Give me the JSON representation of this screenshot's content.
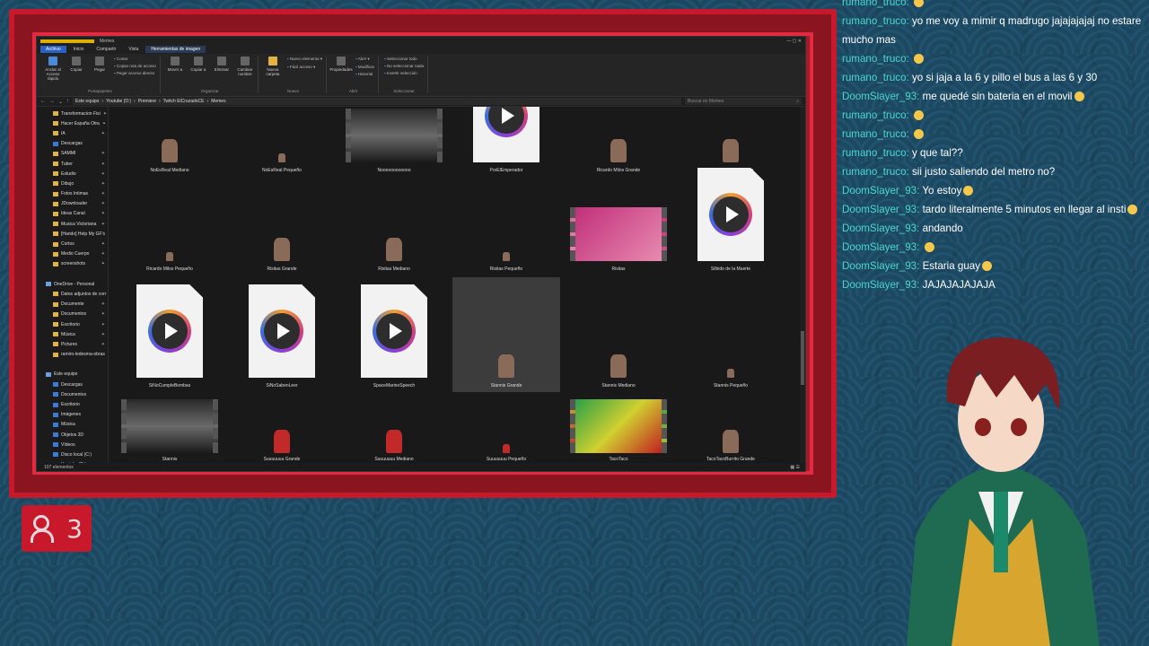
{
  "explorer": {
    "menu": [
      "Archivo",
      "Inicio",
      "Compartir",
      "Vista",
      "Herramientas de imagen"
    ],
    "context_tab": "Memes",
    "ribbon": {
      "portapapeles": {
        "buttons": [
          "Anclar al Acceso rápido",
          "Copiar",
          "Pegar"
        ],
        "small": [
          "Cortar",
          "Copiar ruta de acceso",
          "Pegar acceso directo"
        ],
        "caption": "Portapapeles"
      },
      "organizar": {
        "buttons": [
          "Mover a",
          "Copiar a",
          "Eliminar",
          "Cambiar nombre"
        ],
        "caption": "Organizar"
      },
      "nuevo": {
        "buttons": [
          "Nueva carpeta"
        ],
        "small": [
          "Nuevo elemento ▾",
          "Fácil acceso ▾"
        ],
        "caption": "Nuevo"
      },
      "abrir": {
        "buttons": [
          "Propiedades"
        ],
        "small": [
          "Abrir ▾",
          "Modificar",
          "Historial"
        ],
        "caption": "Abrir"
      },
      "seleccionar": {
        "small": [
          "Seleccionar todo",
          "No seleccionar nada",
          "Invertir selección"
        ],
        "caption": "Seleccionar"
      }
    },
    "breadcrumb": [
      "Este equipo",
      "Youtube (D:)",
      "Premiere",
      "Twitch ElCruzadoCE",
      "Memes"
    ],
    "search_placeholder": "Buscar en Memes",
    "nav_items": [
      {
        "label": "Transformacion Fisi",
        "type": "folder"
      },
      {
        "label": "Hacer España Otra",
        "type": "folder"
      },
      {
        "label": "IA",
        "type": "folder"
      },
      {
        "label": "Descargas",
        "type": "blue"
      },
      {
        "label": "SAMMI",
        "type": "folder"
      },
      {
        "label": "Tuber",
        "type": "folder"
      },
      {
        "label": "Estudio",
        "type": "folder"
      },
      {
        "label": "Dibujo",
        "type": "folder"
      },
      {
        "label": "Fotos Intimas",
        "type": "folder"
      },
      {
        "label": "JDownloader",
        "type": "folder"
      },
      {
        "label": "Ideas Canal",
        "type": "folder"
      },
      {
        "label": "Musica Victoriana",
        "type": "folder"
      },
      {
        "label": "[Hando] Help My GF's",
        "type": "folder"
      },
      {
        "label": "Cortos",
        "type": "folder"
      },
      {
        "label": "Medio Cuerpo",
        "type": "folder"
      },
      {
        "label": "screenshots",
        "type": "folder"
      },
      {
        "label": "",
        "type": "none"
      },
      {
        "label": "OneDrive - Personal",
        "type": "cloud"
      },
      {
        "label": "Datos adjuntos de corr",
        "type": "folder"
      },
      {
        "label": "Documente",
        "type": "folder"
      },
      {
        "label": "Documentos",
        "type": "folder"
      },
      {
        "label": "Escritorio",
        "type": "folder"
      },
      {
        "label": "Música",
        "type": "folder"
      },
      {
        "label": "Pictures",
        "type": "folder"
      },
      {
        "label": "ramiro-ledesma-obras",
        "type": "folder"
      },
      {
        "label": "",
        "type": "none"
      },
      {
        "label": "Este equipo",
        "type": "pc"
      },
      {
        "label": "Descargas",
        "type": "blue"
      },
      {
        "label": "Documentos",
        "type": "blue"
      },
      {
        "label": "Escritorio",
        "type": "blue"
      },
      {
        "label": "Imágenes",
        "type": "blue"
      },
      {
        "label": "Música",
        "type": "blue"
      },
      {
        "label": "Objetos 3D",
        "type": "blue"
      },
      {
        "label": "Vídeos",
        "type": "blue"
      },
      {
        "label": "Disco local (C:)",
        "type": "blue"
      },
      {
        "label": "Youtube (D:)",
        "type": "blue"
      }
    ],
    "files": [
      {
        "name": "NoEsReal Mediano",
        "kind": "fig"
      },
      {
        "name": "NoEsReal Pequeño",
        "kind": "figsm"
      },
      {
        "name": "Noooooooooooo",
        "kind": "film"
      },
      {
        "name": "PorElEmperador",
        "kind": "doc"
      },
      {
        "name": "Ricardo Milos Grande",
        "kind": "fig"
      },
      {
        "name": "Ricardo Milos Mediano",
        "kind": "fig"
      },
      {
        "name": "Ricardo Milos Pequeño",
        "kind": "figsm"
      },
      {
        "name": "Risitas Grande",
        "kind": "fig"
      },
      {
        "name": "Risitas Mediano",
        "kind": "fig"
      },
      {
        "name": "Risitas Pequeño",
        "kind": "figsm"
      },
      {
        "name": "Risitas",
        "kind": "filmpink"
      },
      {
        "name": "Silbido de la Muerte",
        "kind": "doc"
      },
      {
        "name": "SiNoCumpleBombas",
        "kind": "doc"
      },
      {
        "name": "SiNoSabenLeer",
        "kind": "doc"
      },
      {
        "name": "SpaceMarineSpeech",
        "kind": "doc"
      },
      {
        "name": "Stannis Grande",
        "kind": "fig",
        "selected": true
      },
      {
        "name": "Stannis Mediano",
        "kind": "fig"
      },
      {
        "name": "Stannis Pequeño",
        "kind": "figsm"
      },
      {
        "name": "Stannis",
        "kind": "film"
      },
      {
        "name": "Suuuuuuu Grande",
        "kind": "fig"
      },
      {
        "name": "Suuuuuuu Mediano",
        "kind": "fig"
      },
      {
        "name": "Suuuuuuu Pequeño",
        "kind": "figsm"
      },
      {
        "name": "TacoTaco",
        "kind": "filmgreen"
      },
      {
        "name": "TacoTacoBurrito Grande",
        "kind": "fig"
      }
    ],
    "status": "107 elementos"
  },
  "viewers": {
    "count": "3"
  },
  "chat": [
    {
      "user": "rumano_truco:",
      "text": "",
      "emote": true
    },
    {
      "user": "rumano_truco:",
      "text": "yo me voy a mimir q madrugo jajajajajaj no estare mucho mas"
    },
    {
      "user": "rumano_truco:",
      "text": "",
      "emote": true
    },
    {
      "user": "rumano_truco:",
      "text": "yo si jaja a la 6 y pillo el bus a las 6 y 30"
    },
    {
      "user": "DoomSlayer_93:",
      "text": "me quedé sin bateria en el movil",
      "emote": true
    },
    {
      "user": "rumano_truco:",
      "text": "",
      "emote": true
    },
    {
      "user": "rumano_truco:",
      "text": "",
      "emote": true
    },
    {
      "user": "rumano_truco:",
      "text": "y que tal??"
    },
    {
      "user": "rumano_truco:",
      "text": "sii justo saliendo del metro no?"
    },
    {
      "user": "DoomSlayer_93:",
      "text": "Yo estoy",
      "emote": true
    },
    {
      "user": "DoomSlayer_93:",
      "text": "tardo literalmente 5 minutos en llegar al insti",
      "emote": true
    },
    {
      "user": "DoomSlayer_93:",
      "text": "andando"
    },
    {
      "user": "DoomSlayer_93:",
      "text": "",
      "emote": true
    },
    {
      "user": "DoomSlayer_93:",
      "text": "Estaria guay",
      "emote": true
    },
    {
      "user": "DoomSlayer_93:",
      "text": "JAJAJAJAJAJA"
    }
  ]
}
